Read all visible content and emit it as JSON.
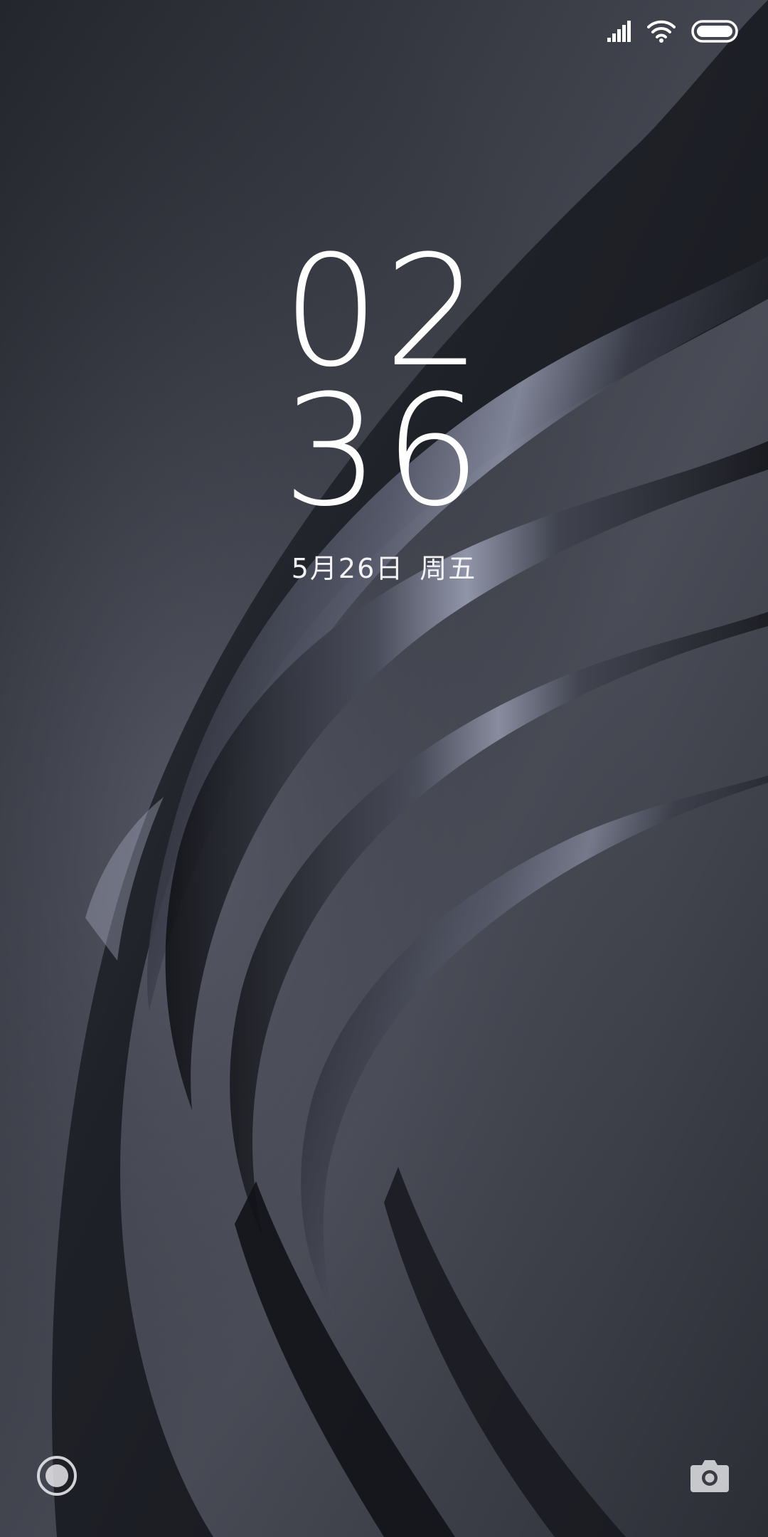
{
  "status_bar": {
    "icons": [
      "cellular-signal-icon",
      "wifi-icon",
      "battery-icon"
    ]
  },
  "clock": {
    "hour": "02",
    "minute": "36"
  },
  "date": {
    "day": "5月26日",
    "weekday": "周五"
  },
  "shortcuts": {
    "left_icon": "voice-assistant-icon",
    "right_icon": "camera-icon"
  },
  "colors": {
    "background": "#2a2c33",
    "text": "#ffffff"
  }
}
